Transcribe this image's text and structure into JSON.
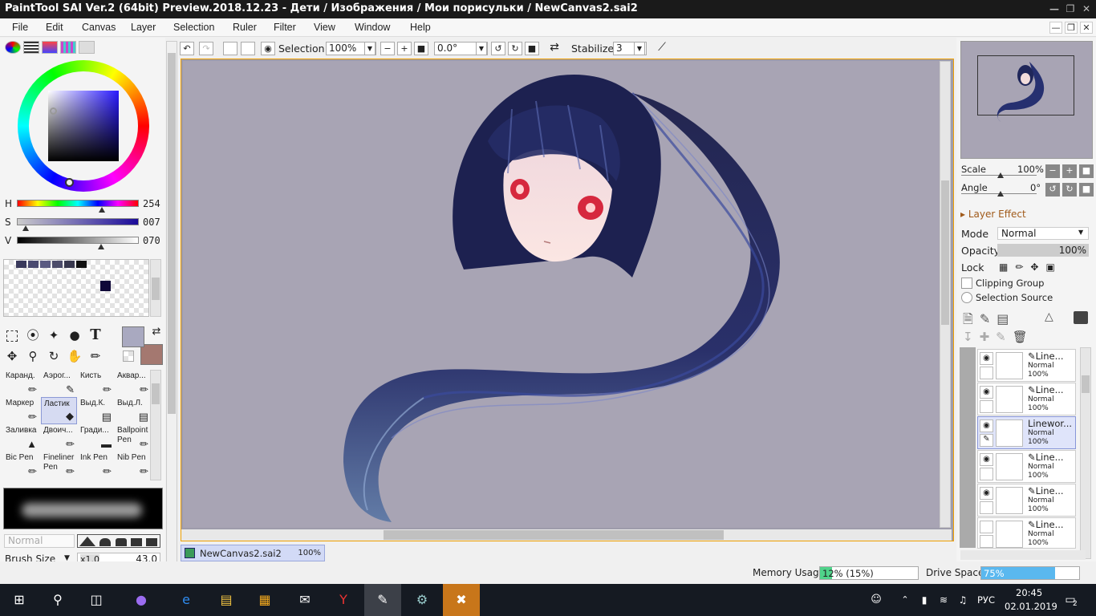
{
  "window": {
    "title": "PaintTool SAI Ver.2 (64bit) Preview.2018.12.23 - Дети / Изображения / Мои порисульки / NewCanvas2.sai2"
  },
  "menu": [
    "File",
    "Edit",
    "Canvas",
    "Layer",
    "Selection",
    "Ruler",
    "Filter",
    "View",
    "Window",
    "Help"
  ],
  "color": {
    "h_label": "H",
    "h_value": "254",
    "s_label": "S",
    "s_value": "007",
    "v_label": "V",
    "v_value": "070",
    "primary": "#a9a9c0",
    "secondary": "#a47870",
    "swatches": [
      "#3a3a5c",
      "#4a4a70",
      "#5a5a82",
      "#4c4c6a",
      "#38384e",
      "#111111"
    ],
    "swatch_single": "#0f0838"
  },
  "tools_label_text": "T",
  "brushes": [
    {
      "label": "Каранд."
    },
    {
      "label": "Аэрог..."
    },
    {
      "label": "Кисть"
    },
    {
      "label": "Аквар..."
    },
    {
      "label": "Маркер"
    },
    {
      "label": "Ластик"
    },
    {
      "label": "Выд.К."
    },
    {
      "label": "Выд.Л."
    },
    {
      "label": "Заливка"
    },
    {
      "label": "Двоич..."
    },
    {
      "label": "Гради..."
    },
    {
      "label": "Ballpoint Pen"
    },
    {
      "label": "Bic Pen"
    },
    {
      "label": "Fineliner Pen"
    },
    {
      "label": "Ink Pen"
    },
    {
      "label": "Nib Pen"
    }
  ],
  "brush_settings": {
    "blend_mode": "Normal",
    "size_label": "Brush Size",
    "size_multiplier": "x1.0",
    "size_value": "43.0"
  },
  "toolbar": {
    "selection_label": "Selection",
    "zoom": "100%",
    "rotation": "0.0°",
    "stabilizer_label": "Stabilizer",
    "stabilizer_value": "3"
  },
  "document_tab": {
    "name": "NewCanvas2.sai2",
    "zoom": "100%"
  },
  "status": {
    "memory_label": "Memory Usage",
    "memory_value": "12% (15%)",
    "memory_fraction": 0.12,
    "drive_label": "Drive Space",
    "drive_value": "75%",
    "drive_fraction": 0.75
  },
  "navigator": {
    "scale_label": "Scale",
    "scale_value": "100%",
    "angle_label": "Angle",
    "angle_value": "0°"
  },
  "layer_props": {
    "effect_label": "Layer Effect",
    "mode_label": "Mode",
    "mode_value": "Normal",
    "opacity_label": "Opacity",
    "opacity_value": "100%",
    "lock_label": "Lock",
    "clipping_label": "Clipping Group",
    "selection_source_label": "Selection Source"
  },
  "layers": [
    {
      "name": "Line...",
      "mode": "Normal",
      "opacity": "100%",
      "visible": true,
      "selected": false
    },
    {
      "name": "Line...",
      "mode": "Normal",
      "opacity": "100%",
      "visible": true,
      "selected": false
    },
    {
      "name": "Linewor...",
      "mode": "Normal",
      "opacity": "100%",
      "visible": true,
      "selected": true
    },
    {
      "name": "Line...",
      "mode": "Normal",
      "opacity": "100%",
      "visible": true,
      "selected": false
    },
    {
      "name": "Line...",
      "mode": "Normal",
      "opacity": "100%",
      "visible": true,
      "selected": false
    },
    {
      "name": "Line...",
      "mode": "Normal",
      "opacity": "100%",
      "visible": false,
      "selected": false
    }
  ],
  "taskbar": {
    "language": "РУС",
    "time": "20:45",
    "date": "02.01.2019",
    "notifications": "2"
  }
}
